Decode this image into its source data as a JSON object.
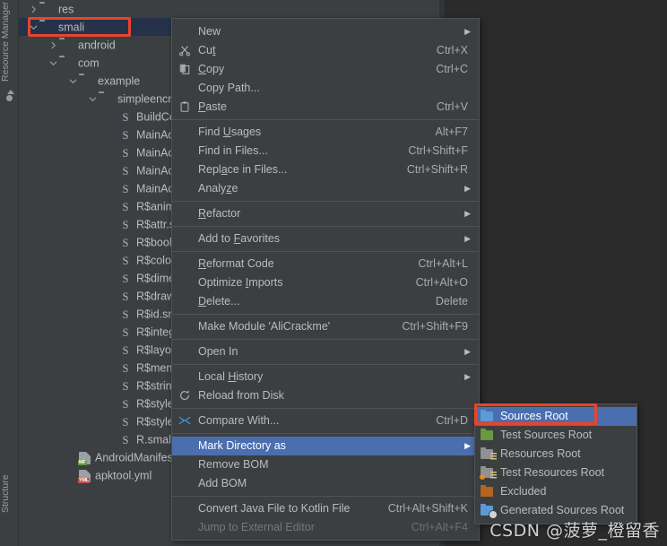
{
  "ide": {
    "left_strip": {
      "top_label": "Resource Manager",
      "bottom_label": "Structure"
    }
  },
  "project_tree": {
    "rows": [
      {
        "label": "res",
        "type": "folder",
        "indent": 0,
        "arrow": "collapsed",
        "selected": false
      },
      {
        "label": "smali",
        "type": "folder",
        "indent": 0,
        "arrow": "expanded",
        "selected": true
      },
      {
        "label": "android",
        "type": "folder",
        "indent": 1,
        "arrow": "collapsed",
        "selected": false
      },
      {
        "label": "com",
        "type": "folder",
        "indent": 1,
        "arrow": "expanded",
        "selected": false
      },
      {
        "label": "example",
        "type": "folder",
        "indent": 2,
        "arrow": "expanded",
        "selected": false
      },
      {
        "label": "simpleencry",
        "type": "folder",
        "indent": 3,
        "arrow": "expanded",
        "selected": false
      },
      {
        "label": "BuildCo",
        "type": "smali",
        "indent": 4,
        "arrow": "none",
        "selected": false
      },
      {
        "label": "MainAct",
        "type": "smali",
        "indent": 4,
        "arrow": "none",
        "selected": false
      },
      {
        "label": "MainAct",
        "type": "smali",
        "indent": 4,
        "arrow": "none",
        "selected": false
      },
      {
        "label": "MainAct",
        "type": "smali",
        "indent": 4,
        "arrow": "none",
        "selected": false
      },
      {
        "label": "MainAct",
        "type": "smali",
        "indent": 4,
        "arrow": "none",
        "selected": false
      },
      {
        "label": "R$anim.",
        "type": "smali",
        "indent": 4,
        "arrow": "none",
        "selected": false
      },
      {
        "label": "R$attr.s",
        "type": "smali",
        "indent": 4,
        "arrow": "none",
        "selected": false
      },
      {
        "label": "R$bool.",
        "type": "smali",
        "indent": 4,
        "arrow": "none",
        "selected": false
      },
      {
        "label": "R$color.",
        "type": "smali",
        "indent": 4,
        "arrow": "none",
        "selected": false
      },
      {
        "label": "R$dimer",
        "type": "smali",
        "indent": 4,
        "arrow": "none",
        "selected": false
      },
      {
        "label": "R$drawa",
        "type": "smali",
        "indent": 4,
        "arrow": "none",
        "selected": false
      },
      {
        "label": "R$id.sm",
        "type": "smali",
        "indent": 4,
        "arrow": "none",
        "selected": false
      },
      {
        "label": "R$integ",
        "type": "smali",
        "indent": 4,
        "arrow": "none",
        "selected": false
      },
      {
        "label": "R$layou",
        "type": "smali",
        "indent": 4,
        "arrow": "none",
        "selected": false
      },
      {
        "label": "R$menu",
        "type": "smali",
        "indent": 4,
        "arrow": "none",
        "selected": false
      },
      {
        "label": "R$string",
        "type": "smali",
        "indent": 4,
        "arrow": "none",
        "selected": false
      },
      {
        "label": "R$style.",
        "type": "smali",
        "indent": 4,
        "arrow": "none",
        "selected": false
      },
      {
        "label": "R$stylea",
        "type": "smali",
        "indent": 4,
        "arrow": "none",
        "selected": false
      },
      {
        "label": "R.smali",
        "type": "smali",
        "indent": 4,
        "arrow": "none",
        "selected": false
      },
      {
        "label": "AndroidManifest.xml",
        "type": "xml",
        "indent": 2,
        "arrow": "none",
        "selected": false
      },
      {
        "label": "apktool.yml",
        "type": "yml",
        "indent": 2,
        "arrow": "none",
        "selected": false
      }
    ]
  },
  "context_menu": {
    "items": [
      {
        "label": "New",
        "shortcut": "",
        "icon": "",
        "submenu": true,
        "separator_after": false,
        "disabled": false,
        "selected": false,
        "mnemonic": -1
      },
      {
        "label": "Cut",
        "shortcut": "Ctrl+X",
        "icon": "scissors-icon",
        "submenu": false,
        "separator_after": false,
        "disabled": false,
        "selected": false,
        "mnemonic": 2
      },
      {
        "label": "Copy",
        "shortcut": "Ctrl+C",
        "icon": "copy-icon",
        "submenu": false,
        "separator_after": false,
        "disabled": false,
        "selected": false,
        "mnemonic": 0
      },
      {
        "label": "Copy Path...",
        "shortcut": "",
        "icon": "",
        "submenu": false,
        "separator_after": false,
        "disabled": false,
        "selected": false,
        "mnemonic": -1
      },
      {
        "label": "Paste",
        "shortcut": "Ctrl+V",
        "icon": "clipboard-icon",
        "submenu": false,
        "separator_after": true,
        "disabled": false,
        "selected": false,
        "mnemonic": 0
      },
      {
        "label": "Find Usages",
        "shortcut": "Alt+F7",
        "icon": "",
        "submenu": false,
        "separator_after": false,
        "disabled": false,
        "selected": false,
        "mnemonic": 5
      },
      {
        "label": "Find in Files...",
        "shortcut": "Ctrl+Shift+F",
        "icon": "",
        "submenu": false,
        "separator_after": false,
        "disabled": false,
        "selected": false,
        "mnemonic": -1
      },
      {
        "label": "Replace in Files...",
        "shortcut": "Ctrl+Shift+R",
        "icon": "",
        "submenu": false,
        "separator_after": false,
        "disabled": false,
        "selected": false,
        "mnemonic": 4
      },
      {
        "label": "Analyze",
        "shortcut": "",
        "icon": "",
        "submenu": true,
        "separator_after": true,
        "disabled": false,
        "selected": false,
        "mnemonic": 5
      },
      {
        "label": "Refactor",
        "shortcut": "",
        "icon": "",
        "submenu": true,
        "separator_after": true,
        "disabled": false,
        "selected": false,
        "mnemonic": 0
      },
      {
        "label": "Add to Favorites",
        "shortcut": "",
        "icon": "",
        "submenu": true,
        "separator_after": true,
        "disabled": false,
        "selected": false,
        "mnemonic": 7
      },
      {
        "label": "Reformat Code",
        "shortcut": "Ctrl+Alt+L",
        "icon": "",
        "submenu": false,
        "separator_after": false,
        "disabled": false,
        "selected": false,
        "mnemonic": 0
      },
      {
        "label": "Optimize Imports",
        "shortcut": "Ctrl+Alt+O",
        "icon": "",
        "submenu": false,
        "separator_after": false,
        "disabled": false,
        "selected": false,
        "mnemonic": 9
      },
      {
        "label": "Delete...",
        "shortcut": "Delete",
        "icon": "",
        "submenu": false,
        "separator_after": true,
        "disabled": false,
        "selected": false,
        "mnemonic": 0
      },
      {
        "label": "Make Module 'AliCrackme'",
        "shortcut": "Ctrl+Shift+F9",
        "icon": "",
        "submenu": false,
        "separator_after": true,
        "disabled": false,
        "selected": false,
        "mnemonic": -1
      },
      {
        "label": "Open In",
        "shortcut": "",
        "icon": "",
        "submenu": true,
        "separator_after": true,
        "disabled": false,
        "selected": false,
        "mnemonic": -1
      },
      {
        "label": "Local History",
        "shortcut": "",
        "icon": "",
        "submenu": true,
        "separator_after": false,
        "disabled": false,
        "selected": false,
        "mnemonic": 6
      },
      {
        "label": "Reload from Disk",
        "shortcut": "",
        "icon": "reload-icon",
        "submenu": false,
        "separator_after": true,
        "disabled": false,
        "selected": false,
        "mnemonic": -1
      },
      {
        "label": "Compare With...",
        "shortcut": "Ctrl+D",
        "icon": "compare-icon",
        "submenu": false,
        "separator_after": true,
        "disabled": false,
        "selected": false,
        "mnemonic": -1
      },
      {
        "label": "Mark Directory as",
        "shortcut": "",
        "icon": "",
        "submenu": true,
        "separator_after": false,
        "disabled": false,
        "selected": true,
        "mnemonic": -1
      },
      {
        "label": "Remove BOM",
        "shortcut": "",
        "icon": "",
        "submenu": false,
        "separator_after": false,
        "disabled": false,
        "selected": false,
        "mnemonic": -1
      },
      {
        "label": "Add BOM",
        "shortcut": "",
        "icon": "",
        "submenu": false,
        "separator_after": true,
        "disabled": false,
        "selected": false,
        "mnemonic": -1
      },
      {
        "label": "Convert Java File to Kotlin File",
        "shortcut": "Ctrl+Alt+Shift+K",
        "icon": "",
        "submenu": false,
        "separator_after": false,
        "disabled": false,
        "selected": false,
        "mnemonic": -1
      },
      {
        "label": "Jump to External Editor",
        "shortcut": "Ctrl+Alt+F4",
        "icon": "",
        "submenu": false,
        "separator_after": false,
        "disabled": true,
        "selected": false,
        "mnemonic": -1
      }
    ]
  },
  "mark_directory_submenu": {
    "items": [
      {
        "label": "Sources Root",
        "icon": "folder-blue-icon",
        "selected": true
      },
      {
        "label": "Test Sources Root",
        "icon": "folder-green-icon",
        "selected": false
      },
      {
        "label": "Resources Root",
        "icon": "folder-resources-icon",
        "selected": false
      },
      {
        "label": "Test Resources Root",
        "icon": "folder-test-resources-icon",
        "selected": false
      },
      {
        "label": "Excluded",
        "icon": "folder-brown-icon",
        "selected": false
      },
      {
        "label": "Generated Sources Root",
        "icon": "folder-generated-icon",
        "selected": false
      }
    ]
  },
  "watermark": {
    "text": "CSDN @菠萝_橙留香"
  },
  "colors": {
    "panel_bg": "#3c3f41",
    "editor_bg": "#2b2b2b",
    "selection_blue": "#4b6eaf",
    "tree_selection": "#26324a",
    "annotation_red": "#e8442c",
    "text": "#bbbbbb"
  }
}
